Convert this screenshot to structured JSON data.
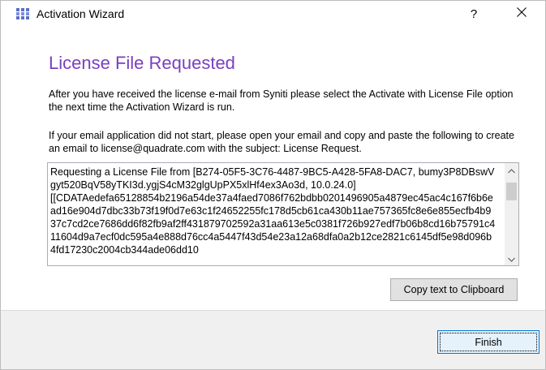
{
  "window": {
    "title": "Activation Wizard",
    "help_label": "?"
  },
  "heading": "License File Requested",
  "paragraph1": "After you have received the license e-mail from Syniti please select the Activate with License File option the next time the Activation Wizard is run.",
  "paragraph2": "If your email application did not start, please open your email and copy and paste the following to create an email to license@quadrate.com with the subject: License Request.",
  "request_text": "Requesting a License File from [B274-05F5-3C76-4487-9BC5-A428-5FA8-DAC7, bumy3P8DBswVgyt520BqV58yTKI3d.ygjS4cM32glgUpPX5xlHf4ex3Ao3d, 10.0.24.0]\n[[CDATAedefa65128854b2196a54de37a4faed7086f762bdbb0201496905a4879ec45ac4c167f6b6ead16e904d7dbc33b73f19f0d7e63c1f24652255fc178d5cb61ca430b11ae757365fc8e6e855ecfb4b937c7cd2ce7686dd6f82fb9af2ff431879702592a31aa613e5c0381f726b927edf7b06b8cd16b75791c411604d9a7ecf0dc595a4e888d76cc4a5447f43d54e23a12a68dfa0a2b12ce2821c6145df5e98d096b4fd17230c2004cb344ade06dd10",
  "buttons": {
    "copy": "Copy text to Clipboard",
    "finish": "Finish"
  },
  "icons": {
    "app": "app-grid-icon",
    "close": "close-icon",
    "scroll_up": "chevron-up-icon",
    "scroll_down": "chevron-down-icon"
  },
  "colors": {
    "heading": "#7a3fbf",
    "app_icon": "#5b6fc7"
  }
}
